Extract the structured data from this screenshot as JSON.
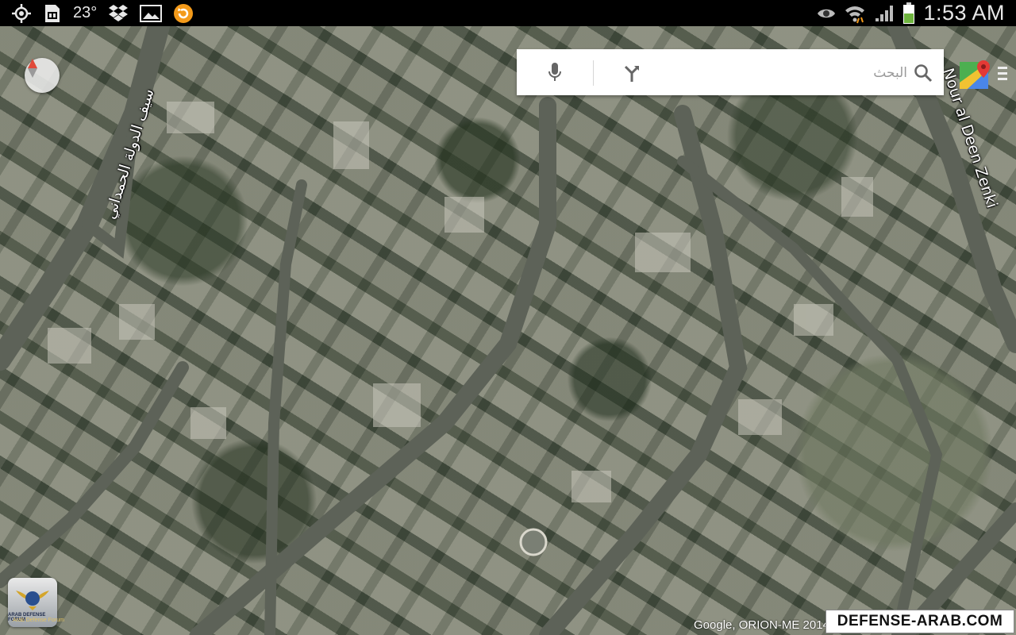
{
  "status_bar": {
    "temperature": "23°",
    "time": "1:53 AM",
    "left_icons": [
      "gps-icon",
      "sim-card-icon",
      "dropbox-icon",
      "gallery-icon",
      "sync-app-icon"
    ],
    "right_icons": [
      "eye-icon",
      "wifi-icon",
      "signal-icon",
      "battery-icon"
    ]
  },
  "search": {
    "placeholder": "البحث",
    "value": ""
  },
  "map": {
    "type": "satellite",
    "street_labels": {
      "left_road": "سيف الدولة الحمداني",
      "right_road": "Nour al Deen Zenki"
    },
    "attribution": "Google, ORION-ME 2014"
  },
  "watermark": {
    "site": "DEFENSE-ARAB.COM",
    "logo_title": "ARAB DEFENSE FORUM",
    "logo_sub": "Arab Defense Forum"
  },
  "colors": {
    "status_bar_bg": "#000000",
    "search_bg": "#ffffff",
    "compass_needle": "#e04a3a",
    "battery_level": "#6fb43f"
  }
}
